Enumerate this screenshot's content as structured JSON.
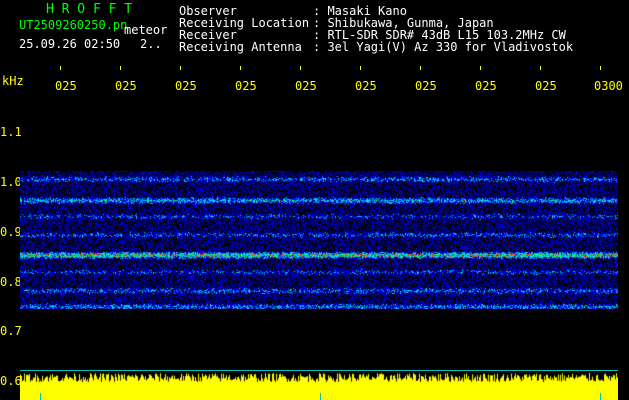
{
  "header": {
    "brand": "H R O F F T",
    "filename": "UT2509260250.pn",
    "label_meteor": "meteor",
    "datetime": "25.09.26 02:50",
    "counter": "2..",
    "fields": [
      {
        "key": "Observer",
        "value": ": Masaki Kano"
      },
      {
        "key": "Receiving Location",
        "value": ": Shibukawa, Gunma, Japan"
      },
      {
        "key": "Receiver",
        "value": ": RTL-SDR SDR# 43dB L15 103.2MHz CW"
      },
      {
        "key": "Receiving Antenna",
        "value": ": 3el Yagi(V) Az 330 for Vladivostok"
      }
    ]
  },
  "axis": {
    "unit": "kHz",
    "y_ticks": [
      "1.1",
      "1.0",
      "0.9",
      "0.8",
      "0.7",
      "0.6"
    ],
    "x_ticks": [
      "025",
      "025",
      "025",
      "025",
      "025",
      "025",
      "025",
      "025",
      "025",
      "0300"
    ]
  },
  "colors": {
    "label_yellow": "#ffff00",
    "header_white": "#ffffff",
    "brand_green": "#00ff00",
    "band_blue": "#0000ff",
    "band_cyan": "#00ffff",
    "band_red": "#ff0000",
    "signal_yellow": "#ffff00"
  },
  "spectrogram": {
    "freq_range_khz": [
      0.76,
      1.02
    ],
    "bands_khz": [
      {
        "freq": 1.005,
        "strength": 0.35
      },
      {
        "freq": 0.965,
        "strength": 0.55
      },
      {
        "freq": 0.935,
        "strength": 0.25
      },
      {
        "freq": 0.9,
        "strength": 0.3
      },
      {
        "freq": 0.862,
        "strength": 1.0
      },
      {
        "freq": 0.83,
        "strength": 0.25
      },
      {
        "freq": 0.795,
        "strength": 0.35
      },
      {
        "freq": 0.765,
        "strength": 0.45
      }
    ]
  }
}
